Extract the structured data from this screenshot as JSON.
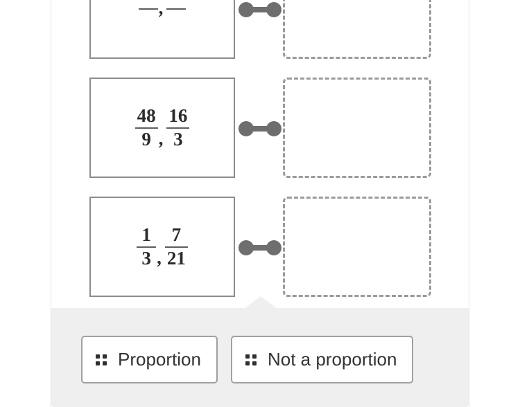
{
  "page": {
    "background": "#ffffff",
    "card_background": "#ffffff",
    "answer_bank_background": "#efefef",
    "tile_border_color": "#8c8c8c",
    "dropzone_border_color": "#9a9a9a",
    "connector_color": "#6e6e6e",
    "text_color": "#2b2b2b"
  },
  "match_rows": [
    {
      "row_name": "row-partial-top",
      "fraction_pair": {
        "left": {
          "numerator": "",
          "denominator": ""
        },
        "separator": ",",
        "right": {
          "numerator": "",
          "denominator": ""
        }
      },
      "connector_icon": "dumbbell-connector-icon",
      "drop_zone_label": "",
      "drop_zone_filled": false
    },
    {
      "row_name": "row-48-9-16-3",
      "fraction_pair": {
        "left": {
          "numerator": "48",
          "denominator": "9"
        },
        "separator": ",",
        "right": {
          "numerator": "16",
          "denominator": "3"
        }
      },
      "connector_icon": "dumbbell-connector-icon",
      "drop_zone_label": "",
      "drop_zone_filled": false
    },
    {
      "row_name": "row-1-3-7-21",
      "fraction_pair": {
        "left": {
          "numerator": "1",
          "denominator": "3"
        },
        "separator": ",",
        "right": {
          "numerator": "7",
          "denominator": "21"
        }
      },
      "connector_icon": "dumbbell-connector-icon",
      "drop_zone_label": "",
      "drop_zone_filled": false
    }
  ],
  "answer_bank": {
    "notch_icon": "triangle-up-notch-icon",
    "choices": [
      {
        "label": "Proportion",
        "handle_icon": "drag-handle-dots-icon"
      },
      {
        "label": "Not a proportion",
        "handle_icon": "drag-handle-dots-icon"
      }
    ]
  }
}
